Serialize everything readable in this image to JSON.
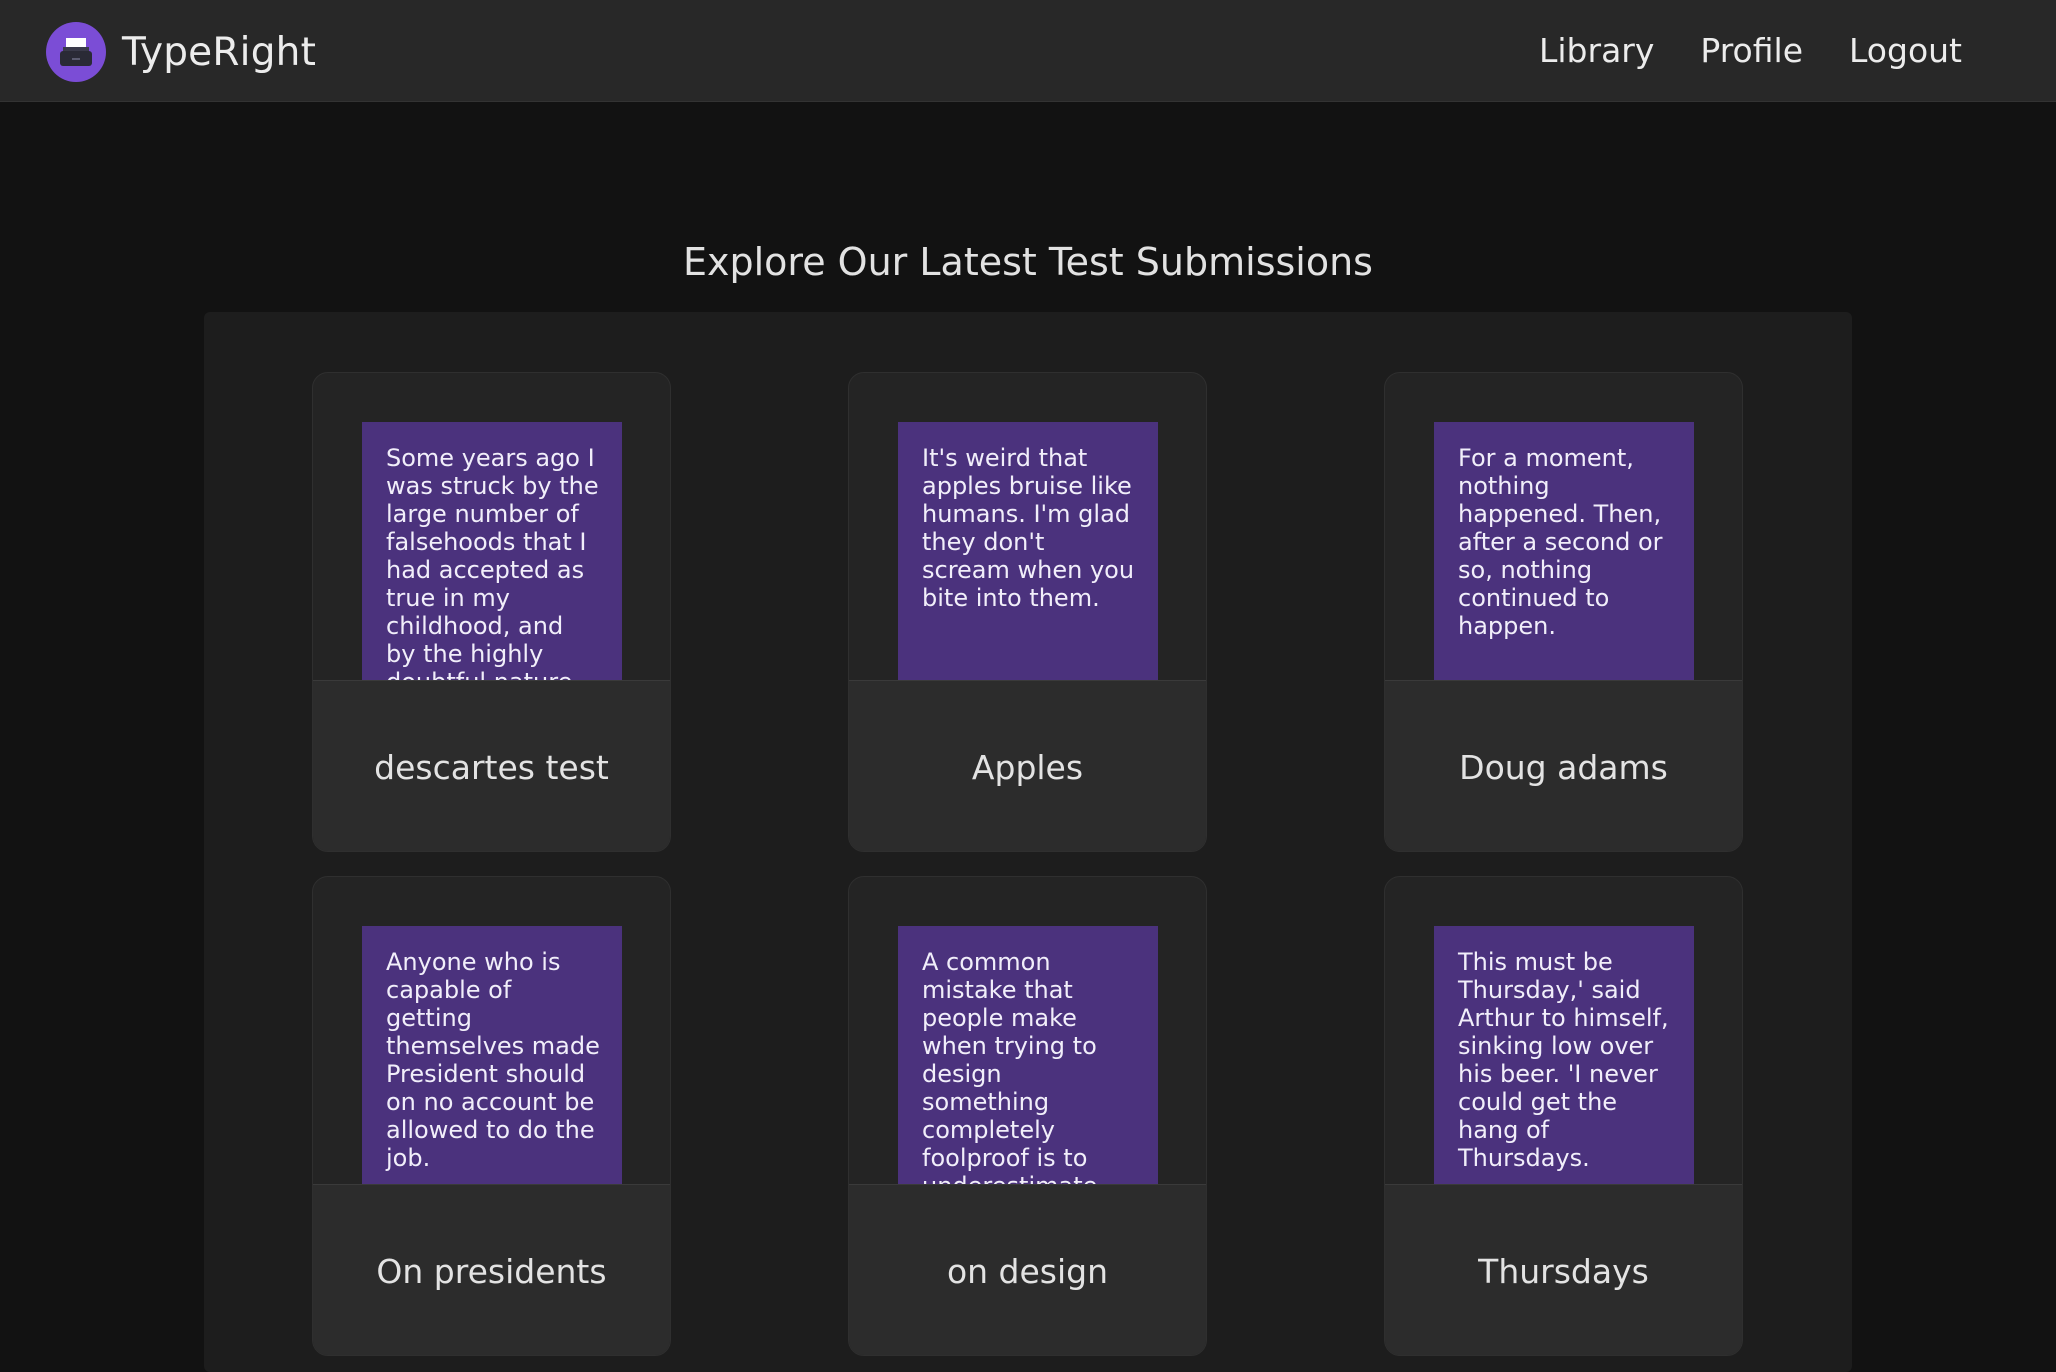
{
  "app": {
    "name": "TypeRight",
    "logo_icon": "typewriter-icon"
  },
  "nav": {
    "links": [
      {
        "label": "Library"
      },
      {
        "label": "Profile"
      },
      {
        "label": "Logout"
      }
    ]
  },
  "main": {
    "heading": "Explore Our Latest Test Submissions",
    "cards": [
      {
        "title": "descartes test",
        "excerpt": "Some years ago I was struck by the large number of falsehoods that I had accepted as true in my childhood, and by the highly doubtful nature"
      },
      {
        "title": "Apples",
        "excerpt": "It's weird that apples bruise like humans. I'm glad they don't scream when you bite into them."
      },
      {
        "title": "Doug adams",
        "excerpt": "For a moment, nothing happened. Then, after a second or so, nothing continued to happen."
      },
      {
        "title": "On presidents",
        "excerpt": "Anyone who is capable of getting themselves made President should on no account be allowed to do the job."
      },
      {
        "title": "on design",
        "excerpt": "A common mistake that people make when trying to design something completely foolproof is to underestimate"
      },
      {
        "title": "Thursdays",
        "excerpt": "This must be Thursday,' said Arthur to himself, sinking low over his beer. 'I never could get the hang of Thursdays."
      }
    ]
  },
  "colors": {
    "accent": "#7b4dd6",
    "excerpt_bg": "#4b327d",
    "nav_bg": "#282828",
    "page_bg": "#121212"
  }
}
